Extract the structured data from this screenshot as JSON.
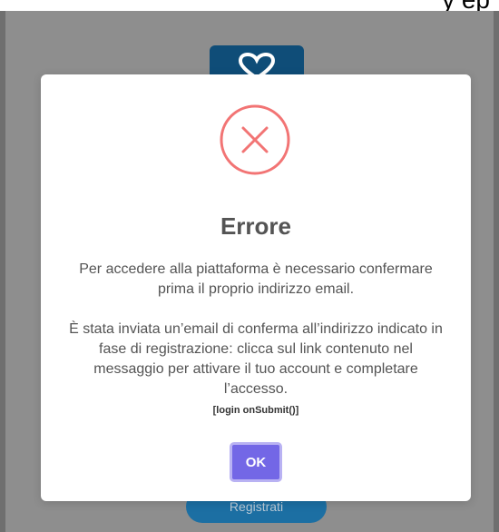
{
  "top_text": "y ep",
  "register_button": "Registrati",
  "modal": {
    "icon": "error-x-icon",
    "title": "Errore",
    "paragraph_1": "Per accedere alla piattaforma è necessario confermare prima il proprio indirizzo email.",
    "paragraph_2": "È stata inviata un’email di conferma all’indirizzo indicato in fase di registrazione: clicca sul link contenuto nel messaggio per attivare il tuo account e completare l’accesso.",
    "code": "[login onSubmit()]",
    "ok_label": "OK"
  },
  "colors": {
    "accent": "#7367e6",
    "error": "#f27474",
    "logo_bg": "#0f4d78",
    "register_bg": "#1c6fa3",
    "overlay": "#8e8e8e"
  }
}
